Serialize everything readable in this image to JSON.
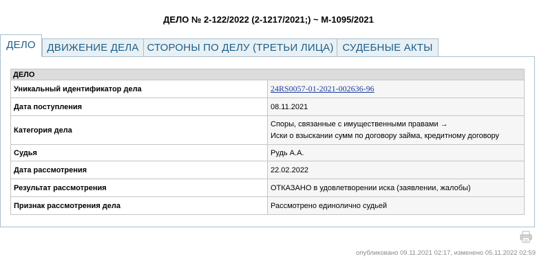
{
  "case": {
    "title": "ДЕЛО № 2-122/2022 (2-1217/2021;) ~ М-1095/2021"
  },
  "tabs": [
    {
      "label": "ДЕЛО",
      "active": true
    },
    {
      "label": "ДВИЖЕНИЕ ДЕЛА",
      "active": false
    },
    {
      "label": "СТОРОНЫ ПО ДЕЛУ (ТРЕТЬИ ЛИЦА)",
      "active": false
    },
    {
      "label": "СУДЕБНЫЕ АКТЫ",
      "active": false
    }
  ],
  "table": {
    "header": "ДЕЛО",
    "rows": [
      {
        "label": "Уникальный идентификатор дела",
        "value": "24RS0057-01-2021-002636-96"
      },
      {
        "label": "Дата поступления",
        "value": "08.11.2021"
      },
      {
        "label": "Категория дела",
        "value_line1": "Споры, связанные с имущественными правами →",
        "value_line2": "Иски о взыскании сумм по договору займа, кредитному договору"
      },
      {
        "label": "Судья",
        "value": "Рудь А.А."
      },
      {
        "label": "Дата рассмотрения",
        "value": "22.02.2022"
      },
      {
        "label": "Результат рассмотрения",
        "value": "ОТКАЗАНО в удовлетворении иска (заявлении, жалобы)"
      },
      {
        "label": "Признак рассмотрения дела",
        "value": "Рассмотрено единолично судьей"
      }
    ]
  },
  "footer": {
    "text": "опубликовано 09.11.2021 02:17, изменено 05.11.2022 02:59"
  },
  "icons": {
    "print": "print-icon"
  },
  "colors": {
    "tab_text": "#1b5f89",
    "tab_bg": "#e9f0f4",
    "header_bg": "#dcdcdc",
    "link": "#1b3d9b"
  }
}
